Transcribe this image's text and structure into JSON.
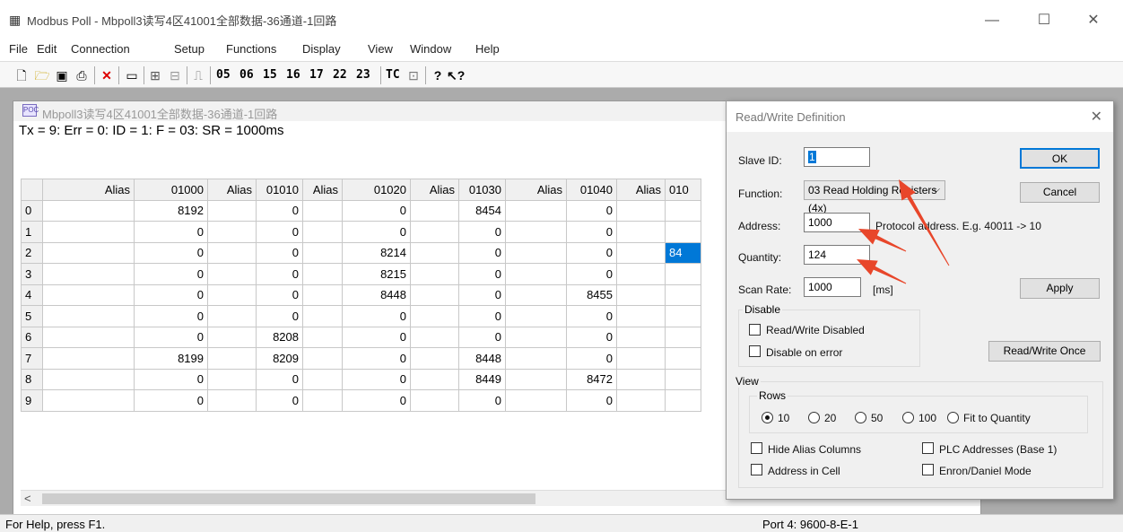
{
  "window": {
    "title": "Modbus Poll - Mbpoll3读写4区41001全部数据-36通道-1回路",
    "minimize": "—",
    "maximize": "☐",
    "close": "✕"
  },
  "menu": [
    "File",
    "Edit",
    "Connection",
    "Setup",
    "Functions",
    "Display",
    "View",
    "Window",
    "Help"
  ],
  "toolbar": {
    "codes": [
      "05",
      "06",
      "15",
      "16",
      "17",
      "22",
      "23"
    ],
    "tc_label": "TC"
  },
  "child": {
    "title": "Mbpoll3读写4区41001全部数据-36通道-1回路",
    "status_line": "Tx = 9: Err = 0: ID = 1: F = 03: SR = 1000ms",
    "columns": [
      "Alias",
      "01000",
      "Alias",
      "01010",
      "Alias",
      "01020",
      "Alias",
      "01030",
      "Alias",
      "01040",
      "Alias",
      "010"
    ],
    "rows": [
      {
        "index": "0",
        "cells": [
          "",
          "8192",
          "",
          "0",
          "",
          "0",
          "",
          "8454",
          "",
          "0",
          "",
          ""
        ]
      },
      {
        "index": "1",
        "cells": [
          "",
          "0",
          "",
          "0",
          "",
          "0",
          "",
          "0",
          "",
          "0",
          "",
          ""
        ]
      },
      {
        "index": "2",
        "cells": [
          "",
          "0",
          "",
          "0",
          "",
          "8214",
          "",
          "0",
          "",
          "0",
          "",
          "84"
        ]
      },
      {
        "index": "3",
        "cells": [
          "",
          "0",
          "",
          "0",
          "",
          "8215",
          "",
          "0",
          "",
          "0",
          "",
          ""
        ]
      },
      {
        "index": "4",
        "cells": [
          "",
          "0",
          "",
          "0",
          "",
          "8448",
          "",
          "0",
          "",
          "8455",
          "",
          ""
        ]
      },
      {
        "index": "5",
        "cells": [
          "",
          "0",
          "",
          "0",
          "",
          "0",
          "",
          "0",
          "",
          "0",
          "",
          ""
        ]
      },
      {
        "index": "6",
        "cells": [
          "",
          "0",
          "",
          "8208",
          "",
          "0",
          "",
          "0",
          "",
          "0",
          "",
          ""
        ]
      },
      {
        "index": "7",
        "cells": [
          "",
          "8199",
          "",
          "8209",
          "",
          "0",
          "",
          "8448",
          "",
          "0",
          "",
          ""
        ]
      },
      {
        "index": "8",
        "cells": [
          "",
          "0",
          "",
          "0",
          "",
          "0",
          "",
          "8449",
          "",
          "8472",
          "",
          ""
        ]
      },
      {
        "index": "9",
        "cells": [
          "",
          "0",
          "",
          "0",
          "",
          "0",
          "",
          "0",
          "",
          "0",
          "",
          ""
        ]
      }
    ],
    "scroll_left": "<"
  },
  "statusbar": {
    "help": "For Help, press F1.",
    "port": "Port 4: 9600-8-E-1"
  },
  "dialog": {
    "title": "Read/Write Definition",
    "close": "✕",
    "slave_id_label": "Slave ID:",
    "slave_id_value": "1",
    "function_label": "Function:",
    "function_value": "03 Read Holding Registers (4x)",
    "address_label": "Address:",
    "address_value": "1000",
    "address_hint": "Protocol address. E.g. 40011 -> 10",
    "quantity_label": "Quantity:",
    "quantity_value": "124",
    "scan_rate_label": "Scan Rate:",
    "scan_rate_value": "1000",
    "scan_rate_unit": "[ms]",
    "ok": "OK",
    "cancel": "Cancel",
    "apply": "Apply",
    "read_write_once": "Read/Write Once",
    "disable_group": "Disable",
    "rw_disabled": "Read/Write Disabled",
    "disable_on_error": "Disable on error",
    "view_group": "View",
    "rows_group": "Rows",
    "row_options": [
      "10",
      "20",
      "50",
      "100",
      "Fit to Quantity"
    ],
    "row_selected": "10",
    "hide_alias": "Hide Alias Columns",
    "plc_addresses": "PLC Addresses (Base 1)",
    "address_in_cell": "Address in Cell",
    "enron_daniel": "Enron/Daniel Mode"
  },
  "annotation_color": "#e8462a"
}
